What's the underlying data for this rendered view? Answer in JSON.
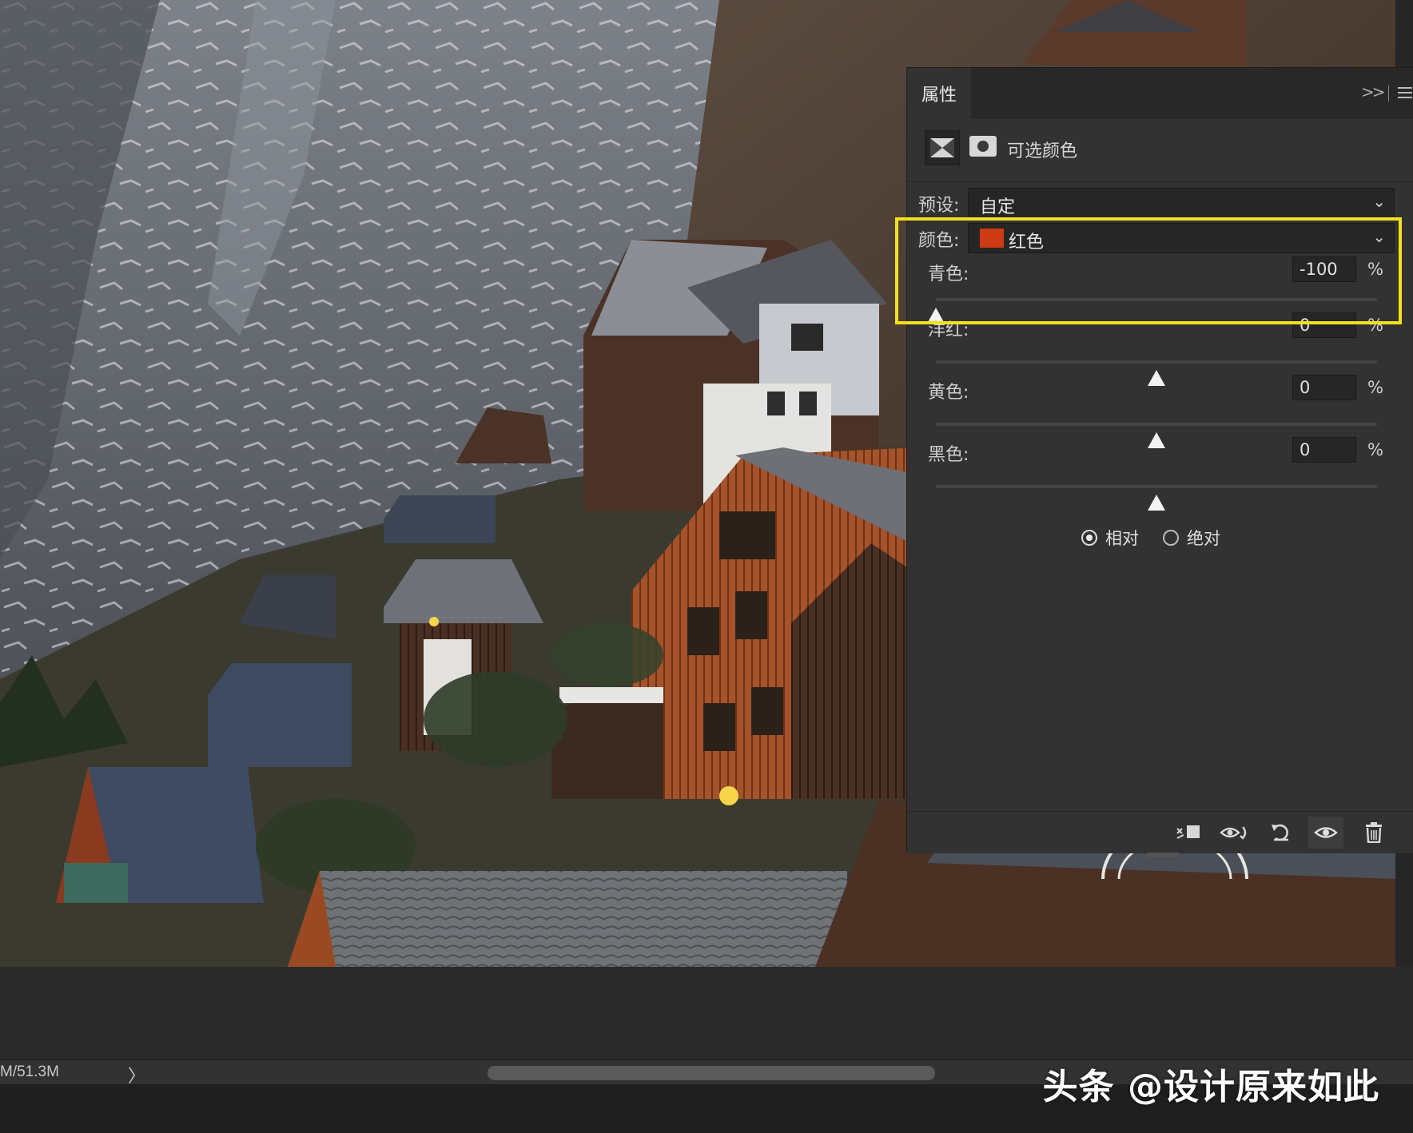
{
  "panel": {
    "tab_label": "属性",
    "adjustment_title": "可选颜色",
    "preset": {
      "label": "预设:",
      "value": "自定"
    },
    "color": {
      "label": "颜色:",
      "value": "红色",
      "swatch": "#cd3b14"
    },
    "sliders": [
      {
        "label": "青色:",
        "value": "-100",
        "unit": "%",
        "level": 0.0
      },
      {
        "label": "洋红:",
        "value": "0",
        "unit": "%",
        "level": 0.5
      },
      {
        "label": "黄色:",
        "value": "0",
        "unit": "%",
        "level": 0.5
      },
      {
        "label": "黑色:",
        "value": "0",
        "unit": "%",
        "level": 0.5
      }
    ],
    "method": {
      "options": [
        "相对",
        "绝对"
      ],
      "selected": "相对"
    },
    "footer_icons": [
      "clip-to-layer-icon",
      "view-previous-state-icon",
      "reset-icon",
      "visibility-eye-icon",
      "trash-icon"
    ]
  },
  "status": {
    "doc_size": "M/51.3M",
    "arrow": "〉"
  },
  "watermark": "头条 @设计原来如此",
  "colors": {
    "highlight": "#f2e11c",
    "panel_bg": "#323232"
  }
}
